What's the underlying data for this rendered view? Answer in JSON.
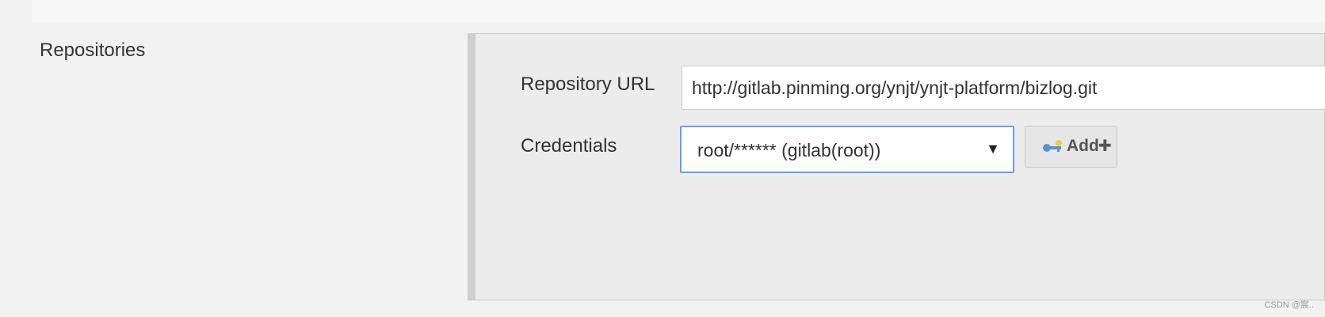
{
  "section": {
    "label": "Repositories"
  },
  "repository": {
    "url_label": "Repository URL",
    "url_value": "http://gitlab.pinming.org/ynjt/ynjt-platform/bizlog.git",
    "credentials_label": "Credentials",
    "credentials_selected": "root/****** (gitlab(root))",
    "credentials_dropdown_icon": "caret-down-icon",
    "add_button": {
      "label": "Add",
      "icon": "key-icon",
      "suffix_icon": "plus-icon"
    }
  },
  "colors": {
    "background": "#f2f2f2",
    "panel": "#ececec",
    "focus_border": "#6a9fe0"
  },
  "watermark": "CSDN @宸.."
}
